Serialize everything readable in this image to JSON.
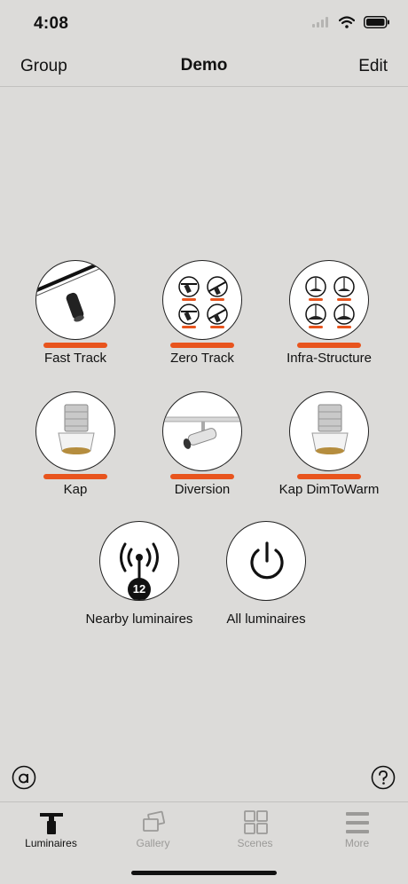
{
  "status": {
    "time": "4:08"
  },
  "nav": {
    "left": "Group",
    "title": "Demo",
    "right": "Edit"
  },
  "groups": [
    {
      "label": "Fast Track",
      "icon": "track-spotlight-icon"
    },
    {
      "label": "Zero Track",
      "icon": "zero-track-grid-icon"
    },
    {
      "label": "Infra-Structure",
      "icon": "pendant-grid-icon"
    },
    {
      "label": "Kap",
      "icon": "downlight-icon"
    },
    {
      "label": "Diversion",
      "icon": "track-projector-icon"
    },
    {
      "label": "Kap DimToWarm",
      "icon": "downlight-icon"
    }
  ],
  "actions": [
    {
      "label": "Nearby luminaires",
      "badge": "12",
      "icon": "antenna-icon"
    },
    {
      "label": "All luminaires",
      "icon": "power-icon"
    }
  ],
  "colors": {
    "accent": "#e8541d",
    "background": "#dcdbd9",
    "inactive": "#9b9a98"
  },
  "tabs": [
    {
      "label": "Luminaires",
      "active": true
    },
    {
      "label": "Gallery",
      "active": false
    },
    {
      "label": "Scenes",
      "active": false
    },
    {
      "label": "More",
      "active": false
    }
  ]
}
